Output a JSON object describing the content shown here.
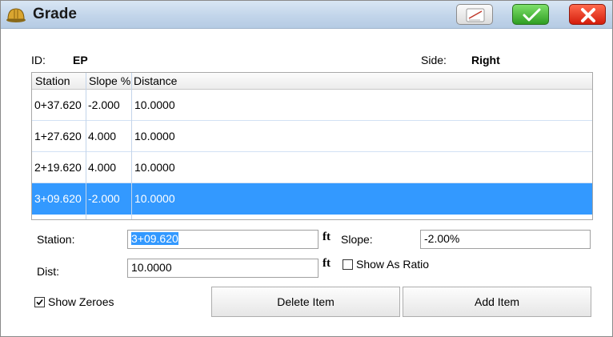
{
  "window": {
    "title": "Grade"
  },
  "info": {
    "id_label": "ID:",
    "id_value": "EP",
    "side_label": "Side:",
    "side_value": "Right"
  },
  "table": {
    "headers": [
      "Station",
      "Slope %",
      "Distance"
    ],
    "rows": [
      {
        "station": "0+37.620",
        "slope": "-2.000",
        "distance": "10.0000"
      },
      {
        "station": "1+27.620",
        "slope": "4.000",
        "distance": "10.0000"
      },
      {
        "station": "2+19.620",
        "slope": "4.000",
        "distance": "10.0000"
      },
      {
        "station": "3+09.620",
        "slope": "-2.000",
        "distance": "10.0000",
        "selected": true
      }
    ]
  },
  "form": {
    "station_label": "Station:",
    "station_value": "3+09.620",
    "unit": "ft",
    "slope_label": "Slope:",
    "slope_value": "-2.00%",
    "dist_label": "Dist:",
    "dist_value": "10.0000",
    "show_as_ratio_label": "Show As Ratio",
    "show_as_ratio_checked": false,
    "show_zeroes_label": "Show Zeroes",
    "show_zeroes_checked": true
  },
  "buttons": {
    "delete_label": "Delete Item",
    "add_label": "Add Item"
  },
  "icons": {
    "app": "hard-hat-icon",
    "note": "note-edit-icon",
    "ok": "checkmark-icon",
    "cancel": "close-icon"
  },
  "colors": {
    "selection": "#3399ff",
    "ok_green": "#2f9e22",
    "cancel_red": "#d41d0c"
  }
}
